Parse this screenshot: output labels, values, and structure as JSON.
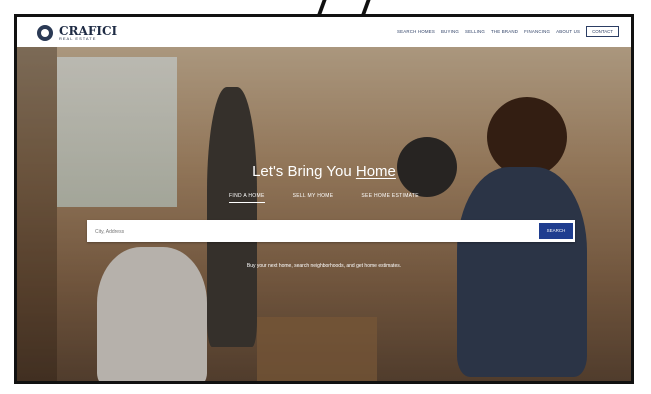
{
  "header": {
    "logo_name": "CRAFICI",
    "logo_sub": "REAL ESTATE",
    "nav": [
      "SEARCH HOMES",
      "BUYING",
      "SELLING",
      "THE BRAND",
      "FINANCING",
      "ABOUT US"
    ],
    "contact_label": "CONTACT"
  },
  "hero": {
    "title_prefix": "Let's Bring You ",
    "title_underlined": "Home",
    "tabs": [
      "FIND A HOME",
      "SELL MY HOME",
      "SEE HOME ESTIMATE"
    ],
    "active_tab": 0,
    "search_placeholder": "City, Address",
    "search_button": "SEARCH",
    "caption": "Buy your next home, search neighborhoods, and get home estimates."
  },
  "colors": {
    "brand": "#1e2b44",
    "accent_button": "#1f3d8f"
  }
}
